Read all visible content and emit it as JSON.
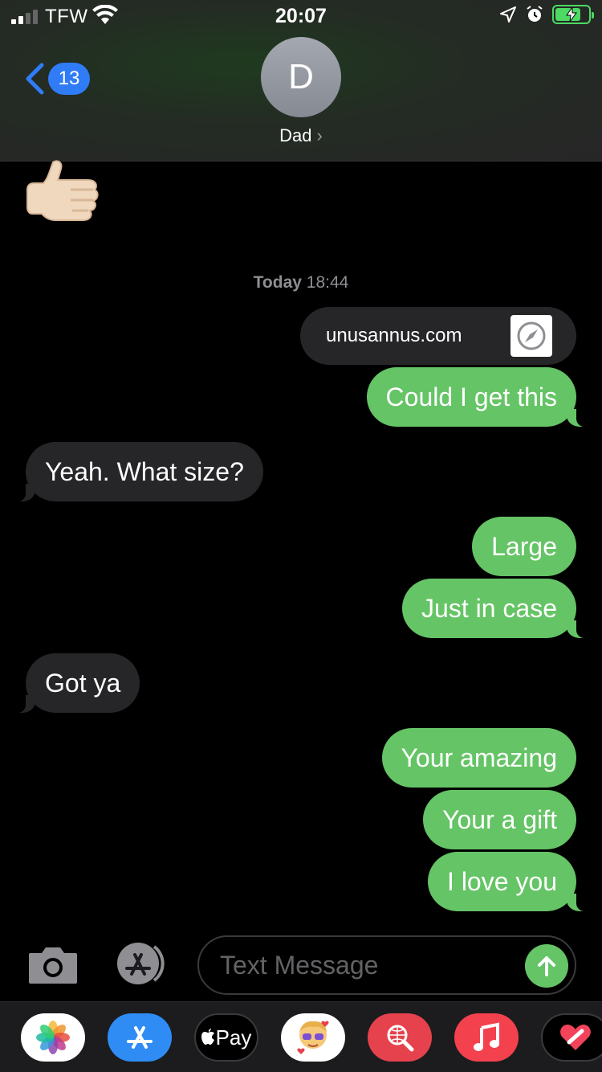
{
  "status_bar": {
    "carrier": "TFW",
    "time": "20:07",
    "battery_color": "#4cd964"
  },
  "header": {
    "back_badge": "13",
    "avatar_initial": "D",
    "contact_name": "Dad",
    "accent": "#2f7cf6"
  },
  "conversation": {
    "timestamp_day": "Today",
    "timestamp_time": "18:44",
    "link_url": "unusannus.com",
    "messages": [
      {
        "direction": "sent",
        "text": "Could I get this"
      },
      {
        "direction": "received",
        "text": "Yeah. What size?"
      },
      {
        "direction": "sent",
        "text": "Large"
      },
      {
        "direction": "sent",
        "text": "Just in case"
      },
      {
        "direction": "received",
        "text": "Got ya"
      },
      {
        "direction": "sent",
        "text": "Your amazing"
      },
      {
        "direction": "sent",
        "text": "Your a gift"
      },
      {
        "direction": "sent",
        "text": "I love you"
      }
    ],
    "sent_color": "#65c466",
    "received_color": "#262628"
  },
  "input": {
    "placeholder": "Text Message"
  },
  "app_drawer": {
    "items": [
      {
        "icon": "photos-icon"
      },
      {
        "icon": "app-store-icon"
      },
      {
        "icon": "apple-pay-icon",
        "label": "Pay"
      },
      {
        "icon": "memoji-icon"
      },
      {
        "icon": "web-search-icon"
      },
      {
        "icon": "music-icon"
      },
      {
        "icon": "digital-touch-icon"
      }
    ]
  }
}
